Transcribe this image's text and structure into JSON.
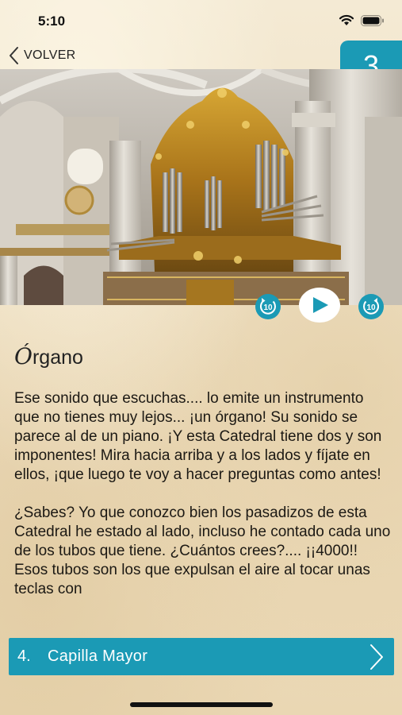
{
  "status_bar": {
    "time": "5:10"
  },
  "nav": {
    "back_label": "VOLVER",
    "stop_number": "3"
  },
  "photo": {
    "subject": "organ-photo"
  },
  "player": {
    "rewind_icon": "rewind-10-icon",
    "play_icon": "play-icon",
    "forward_icon": "forward-10-icon",
    "rewind_text": "10",
    "forward_text": "10"
  },
  "content": {
    "title_initial": "Ó",
    "title_rest": "rgano",
    "paragraphs": [
      "Ese sonido que escuchas.... lo emite un instrumento que no tienes muy lejos... ¡un órgano! Su sonido se parece al de un piano. ¡Y esta Catedral tiene dos y son imponentes! Mira hacia arriba y a los lados y fíjate en ellos, ¡que luego te voy a hacer preguntas como antes!",
      "¿Sabes? Yo que conozco bien los pasadizos de esta Catedral he estado al lado, incluso he contado cada uno de los tubos que tiene. ¿Cuántos crees?.... ¡¡4000!! Esos tubos son los que expulsan el aire al tocar unas teclas con"
    ]
  },
  "next": {
    "number": "4.",
    "label": "Capilla Mayor"
  },
  "colors": {
    "accent": "#1b9ab5",
    "background": "#f1e6cf"
  }
}
